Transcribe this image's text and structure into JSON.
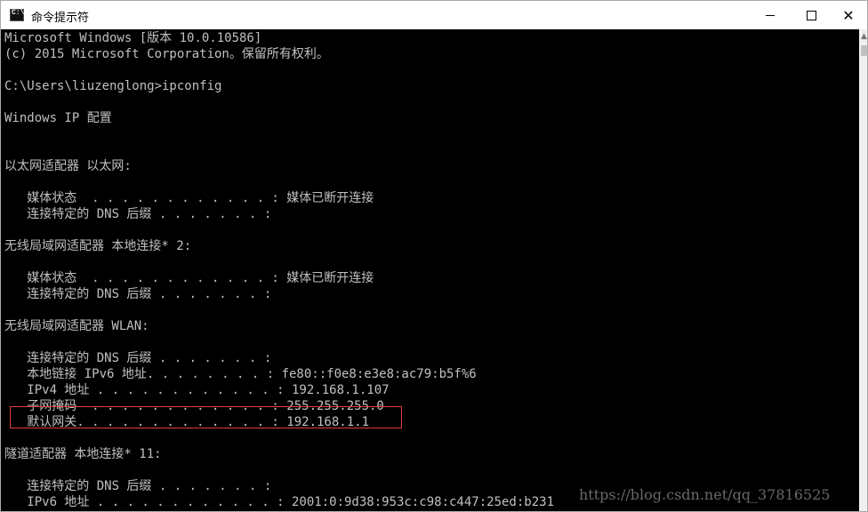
{
  "window": {
    "title": "命令提示符",
    "controls": {
      "minimize": "",
      "maximize": "",
      "close": "✕"
    }
  },
  "terminal": {
    "lines": [
      "Microsoft Windows [版本 10.0.10586]",
      "(c) 2015 Microsoft Corporation。保留所有权利。",
      "C:\\Users\\liuzenglong>ipconfig",
      "Windows IP 配置",
      "以太网适配器 以太网:",
      "   媒体状态  . . . . . . . . . . . . : 媒体已断开连接",
      "   连接特定的 DNS 后缀 . . . . . . . :",
      "无线局域网适配器 本地连接* 2:",
      "   媒体状态  . . . . . . . . . . . . : 媒体已断开连接",
      "   连接特定的 DNS 后缀 . . . . . . . :",
      "无线局域网适配器 WLAN:",
      "   连接特定的 DNS 后缀 . . . . . . . :",
      "   本地链接 IPv6 地址. . . . . . . . : fe80::f0e8:e3e8:ac79:b5f%6",
      "   IPv4 地址 . . . . . . . . . . . . : 192.168.1.107",
      "   子网掩码  . . . . . . . . . . . . : 255.255.255.0",
      "   默认网关. . . . . . . . . . . . . : 192.168.1.1",
      "隧道适配器 本地连接* 11:",
      "   连接特定的 DNS 后缀 . . . . . . . :",
      "   IPv6 地址 . . . . . . . . . . . . : 2001:0:9d38:953c:c98:c447:25ed:b231"
    ]
  },
  "watermark": "https://blog.csdn.net/qq_37816525"
}
